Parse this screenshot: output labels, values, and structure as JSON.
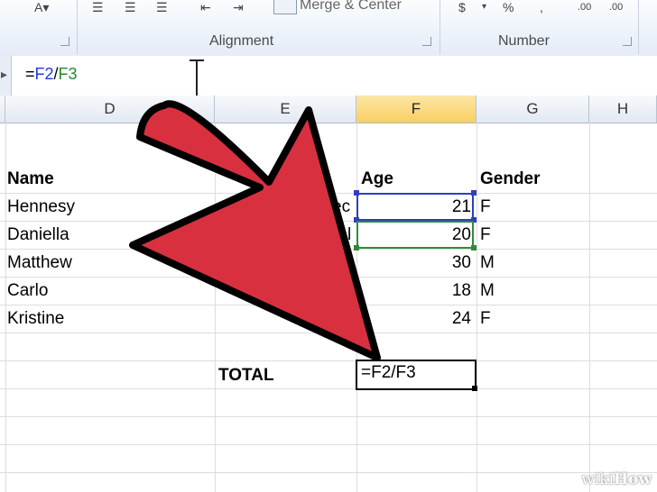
{
  "ribbon": {
    "merge_center_label": "Merge & Center",
    "alignment_label": "Alignment",
    "number_label": "Number",
    "currency_symbol": "$",
    "percent_symbol": "%",
    "comma_symbol": ","
  },
  "formula_bar": {
    "text_prefix": "=",
    "ref1": "F2",
    "operator": "/",
    "ref2": "F3"
  },
  "columns": [
    "D",
    "E",
    "F",
    "G",
    "H"
  ],
  "sheet": {
    "headers": {
      "name": "Name",
      "age": "Age",
      "gender": "Gender"
    },
    "partial_texts": [
      "ec",
      "l"
    ],
    "rows": [
      {
        "name": "Hennesy",
        "age": "21",
        "gender": "F"
      },
      {
        "name": "Daniella",
        "age": "20",
        "gender": "F"
      },
      {
        "name": "Matthew",
        "age": "30",
        "gender": "M"
      },
      {
        "name": "Carlo",
        "age": "18",
        "gender": "M"
      },
      {
        "name": "Kristine",
        "age": "24",
        "gender": "F"
      }
    ],
    "total_label": "TOTAL",
    "active_cell_value": "=F2/F3"
  },
  "watermark": {
    "brand_prefix": "wiki",
    "brand_suffix": "How"
  },
  "colors": {
    "ref1": "#1d3bd6",
    "ref2": "#1f8a2f",
    "arrow_fill": "#d9303f",
    "selected_column": "#f8cf62"
  },
  "icons": [
    "align-left-icon",
    "align-center-icon",
    "align-right-icon",
    "decrease-indent-icon",
    "increase-indent-icon",
    "merge-center-icon",
    "currency-icon",
    "percent-icon",
    "comma-icon",
    "increase-decimal-icon",
    "decrease-decimal-icon",
    "dialog-launcher-icon",
    "text-cursor-icon",
    "pointer-arrow-icon"
  ]
}
